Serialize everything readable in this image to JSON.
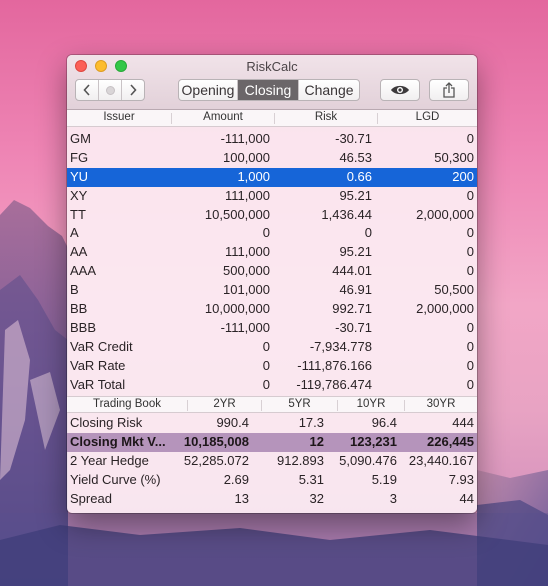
{
  "window": {
    "title": "RiskCalc"
  },
  "toolbar": {
    "tabs": [
      {
        "label": "Opening",
        "active": false
      },
      {
        "label": "Closing",
        "active": true
      },
      {
        "label": "Change",
        "active": false
      }
    ],
    "icons": [
      "chevron-left-icon",
      "circle-icon",
      "chevron-right-icon",
      "eye-icon",
      "share-icon"
    ]
  },
  "issuer_table": {
    "headers": [
      "Issuer",
      "Amount",
      "Risk",
      "LGD"
    ],
    "selected_row": 2,
    "rows": [
      [
        "GM",
        "-111,000",
        "-30.71",
        "0"
      ],
      [
        "FG",
        "100,000",
        "46.53",
        "50,300"
      ],
      [
        "YU",
        "1,000",
        "0.66",
        "200"
      ],
      [
        "XY",
        "111,000",
        "95.21",
        "0"
      ],
      [
        "TT",
        "10,500,000",
        "1,436.44",
        "2,000,000"
      ],
      [
        "A",
        "0",
        "0",
        "0"
      ],
      [
        "AA",
        "111,000",
        "95.21",
        "0"
      ],
      [
        "AAA",
        "500,000",
        "444.01",
        "0"
      ],
      [
        "B",
        "101,000",
        "46.91",
        "50,500"
      ],
      [
        "BB",
        "10,000,000",
        "992.71",
        "2,000,000"
      ],
      [
        "BBB",
        "-111,000",
        "-30.71",
        "0"
      ],
      [
        "VaR Credit",
        "0",
        "-7,934.778",
        "0"
      ],
      [
        "VaR Rate",
        "0",
        "-111,876.166",
        "0"
      ],
      [
        "VaR Total",
        "0",
        "-119,786.474",
        "0"
      ]
    ]
  },
  "trading_table": {
    "headers": [
      "Trading Book",
      "2YR",
      "5YR",
      "10YR",
      "30YR"
    ],
    "highlighted_row": 1,
    "rows": [
      [
        "Closing Risk",
        "990.4",
        "17.3",
        "96.4",
        "444"
      ],
      [
        "Closing Mkt V...",
        "10,185,008",
        "12",
        "123,231",
        "226,445"
      ],
      [
        "2 Year Hedge",
        "52,285.072",
        "912.893",
        "5,090.476",
        "23,440.167"
      ],
      [
        "Yield Curve (%)",
        "2.69",
        "5.31",
        "5.19",
        "7.93"
      ],
      [
        "Spread",
        "13",
        "32",
        "3",
        "44"
      ]
    ]
  },
  "colors": {
    "selection": "#1665d8",
    "highlight_row": "#b594bb",
    "active_tab": "#6b6669"
  }
}
